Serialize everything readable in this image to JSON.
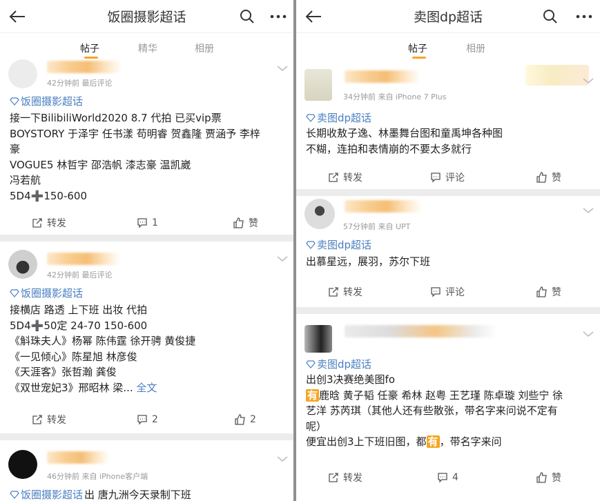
{
  "left": {
    "title": "饭圈摄影超话",
    "tabs": [
      "帖子",
      "精华",
      "相册"
    ],
    "posts": [
      {
        "meta": "42分钟前 最后评论",
        "topic": "饭圈摄影超话",
        "lines": [
          "接一下BilibiliWorld2020 8.7 代拍 已买vip票",
          "BOYSTORY 于泽宇 任书漾 苟明睿 贺鑫隆 贾涵予 李梓",
          "豪",
          "VOGUE5 林哲宇 邵浩帆 漆志豪 温凯崴",
          "冯若航",
          "5D4➕150-600"
        ],
        "repost": "转发",
        "comment": "1",
        "like": "赞"
      },
      {
        "meta": "42分钟前 最后评论",
        "topic": "饭圈摄影超话",
        "lines": [
          "接横店 路透 上下班 出妆 代拍",
          "5D4➕50定 24-70 150-600",
          "《斛珠夫人》杨幂 陈伟霆 徐开骋 黄俊捷",
          "《一见倾心》陈星旭 林彦俊",
          "《天涯客》张哲瀚 龚俊",
          "《双世宠妃3》邢昭林 梁..."
        ],
        "fulltext": "全文",
        "repost": "转发",
        "comment": "2",
        "like": "2"
      },
      {
        "meta": "46分钟前   来自 iPhone客户端",
        "topic": "饭圈摄影超话",
        "after_topic": " 出 唐九洲今天录制下班"
      }
    ]
  },
  "right": {
    "title": "卖图dp超话",
    "tabs": [
      "帖子",
      "相册"
    ],
    "posts": [
      {
        "meta": "34分钟前   来自 iPhone 7 Plus",
        "topic": "卖图dp超话",
        "lines": [
          "长期收敖子逸、林墨舞台图和童禹坤各种图",
          "不糊，连拍和表情崩的不要太多就行"
        ],
        "repost": "转发",
        "comment": "评论",
        "like": "赞"
      },
      {
        "meta": "57分钟前   来自 UPT",
        "topic": "卖图dp超话",
        "lines": [
          "出慕星远，展羽，苏尔下班"
        ],
        "repost": "转发",
        "comment": "评论",
        "like": "赞"
      },
      {
        "topic": "卖图dp超话",
        "lines": [
          "出创3决赛绝美图fo",
          "鹿晗 黄子韬 任豪 希林 赵粤 王艺瑾 陈卓璇 刘些宁 徐",
          "艺洋 苏芮琪（其他人还有些散张，带名字来问说不定有",
          "呢）",
          "便宜出创3上下班旧图，都",
          "，带名字来问"
        ],
        "you_tag": "有",
        "repost": "转发",
        "comment": "4",
        "like": "赞"
      }
    ]
  },
  "colors": {
    "accent": "#f5a623",
    "link": "#4a7fc1",
    "separator": "#ececec"
  }
}
